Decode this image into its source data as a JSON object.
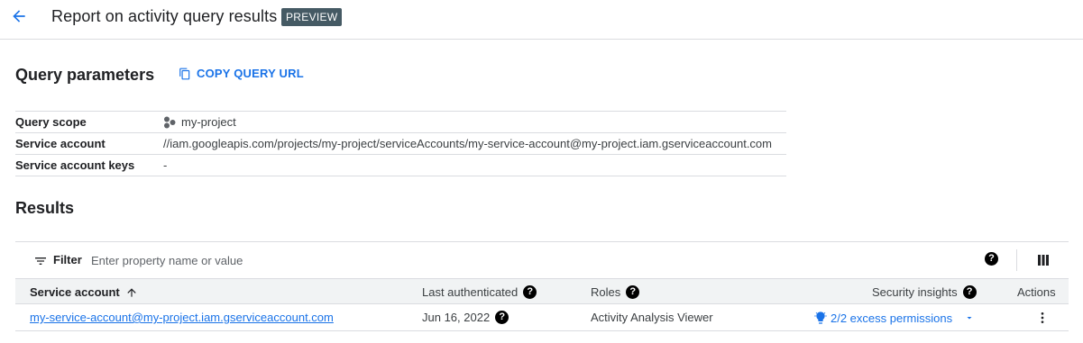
{
  "header": {
    "title": "Report on activity query results",
    "badge": "PREVIEW"
  },
  "query_parameters": {
    "title": "Query parameters",
    "copy_url_label": "COPY QUERY URL",
    "rows": [
      {
        "key": "Query scope",
        "value": "my-project",
        "icon": "project-icon"
      },
      {
        "key": "Service account",
        "value": "//iam.googleapis.com/projects/my-project/serviceAccounts/my-service-account@my-project.iam.gserviceaccount.com"
      },
      {
        "key": "Service account keys",
        "value": "-"
      }
    ]
  },
  "results": {
    "title": "Results",
    "filter": {
      "label": "Filter",
      "placeholder": "Enter property name or value"
    },
    "columns": {
      "service_account": "Service account",
      "last_authenticated": "Last authenticated",
      "roles": "Roles",
      "security_insights": "Security insights",
      "actions": "Actions"
    },
    "sort_indicator": "arrow-up-icon",
    "rows": [
      {
        "service_account": "my-service-account@my-project.iam.gserviceaccount.com",
        "last_authenticated": "Jun 16, 2022",
        "roles": "Activity Analysis Viewer",
        "security_insights": "2/2 excess permissions"
      }
    ]
  },
  "colors": {
    "accent": "#1a73e8",
    "badge_bg": "#455a64",
    "header_bg": "#f1f3f4",
    "divider": "#dadce0"
  }
}
